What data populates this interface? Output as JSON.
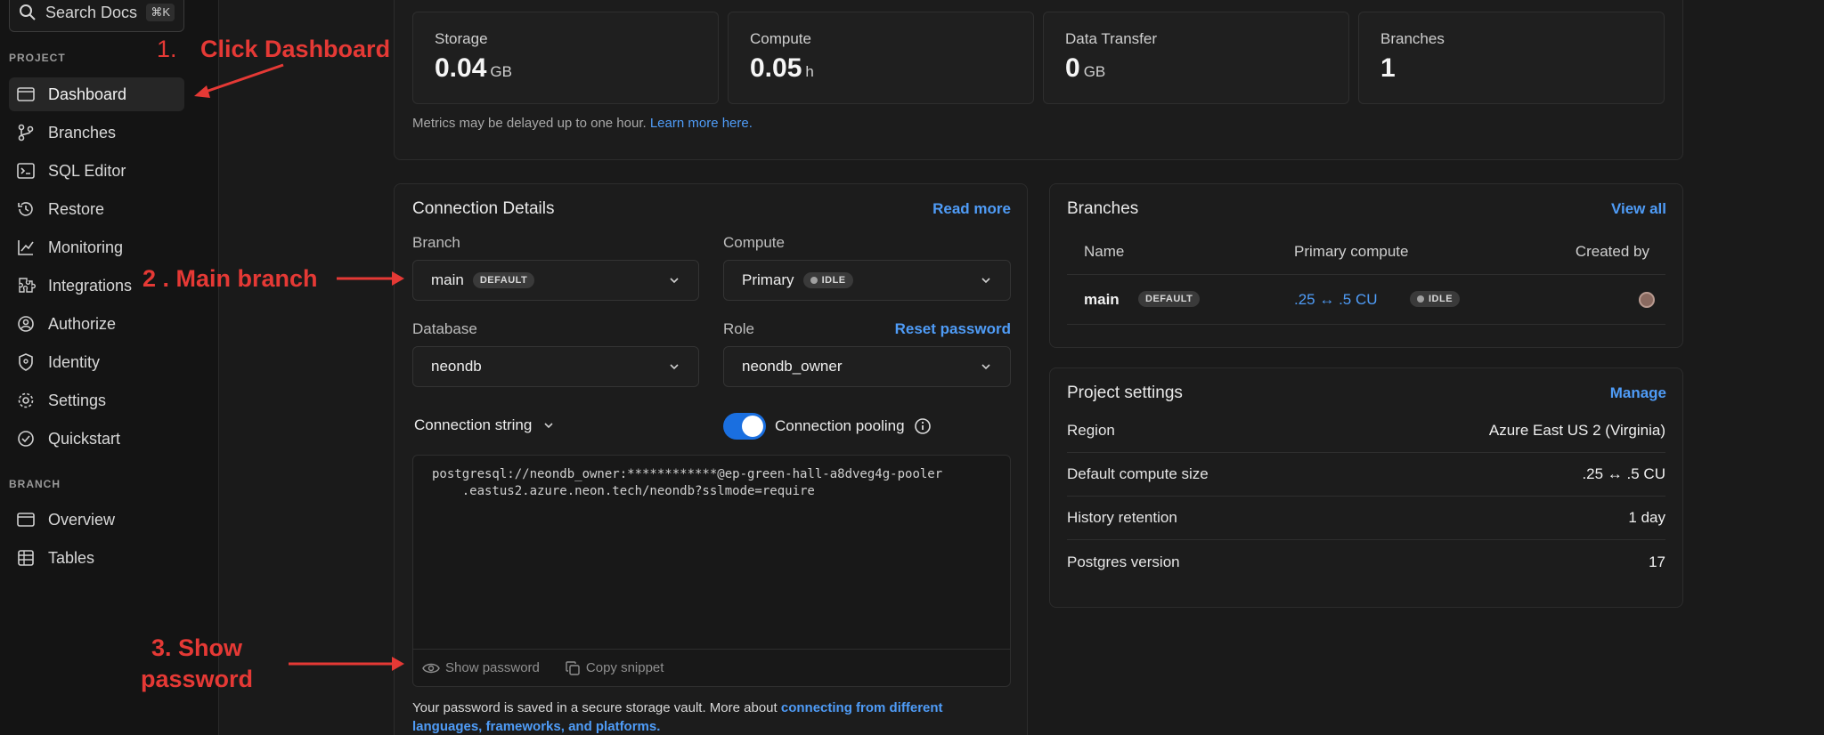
{
  "search": {
    "label": "Search Docs",
    "shortcut": "⌘K"
  },
  "sidebar": {
    "project_label": "PROJECT",
    "branch_label": "BRANCH",
    "project_items": [
      {
        "label": "Dashboard",
        "icon": "dashboard-icon"
      },
      {
        "label": "Branches",
        "icon": "branches-icon"
      },
      {
        "label": "SQL Editor",
        "icon": "sql-editor-icon"
      },
      {
        "label": "Restore",
        "icon": "restore-icon"
      },
      {
        "label": "Monitoring",
        "icon": "monitoring-icon"
      },
      {
        "label": "Integrations",
        "icon": "integrations-icon"
      },
      {
        "label": "Authorize",
        "icon": "authorize-icon"
      },
      {
        "label": "Identity",
        "icon": "identity-icon"
      },
      {
        "label": "Settings",
        "icon": "settings-icon"
      },
      {
        "label": "Quickstart",
        "icon": "quickstart-icon"
      }
    ],
    "branch_items": [
      {
        "label": "Overview",
        "icon": "overview-icon"
      },
      {
        "label": "Tables",
        "icon": "tables-icon"
      }
    ]
  },
  "usage": {
    "stats": [
      {
        "label": "Storage",
        "value": "0.04",
        "unit": "GB"
      },
      {
        "label": "Compute",
        "value": "0.05",
        "unit": "h"
      },
      {
        "label": "Data Transfer",
        "value": "0",
        "unit": "GB"
      },
      {
        "label": "Branches",
        "value": "1",
        "unit": ""
      }
    ],
    "note": "Metrics may be delayed up to one hour.",
    "note_link": "Learn more here."
  },
  "connection": {
    "title": "Connection Details",
    "read_more": "Read more",
    "branch_label": "Branch",
    "branch_value": "main",
    "branch_badge": "DEFAULT",
    "compute_label": "Compute",
    "compute_value": "Primary",
    "compute_badge": "IDLE",
    "database_label": "Database",
    "database_value": "neondb",
    "role_label": "Role",
    "reset_password": "Reset password",
    "role_value": "neondb_owner",
    "conn_string_label": "Connection string",
    "pooling_label": "Connection pooling",
    "pooling_on": true,
    "conn_line1": "postgresql://neondb_owner:************@ep-green-hall-a8dveg4g-pooler",
    "conn_line2": "    .eastus2.azure.neon.tech/neondb?sslmode=require",
    "show_password": "Show password",
    "copy_snippet": "Copy snippet",
    "footer_text": "Your password is saved in a secure storage vault. More about",
    "footer_link1": "connecting from different",
    "footer_link2": "languages, frameworks, and platforms."
  },
  "branches": {
    "title": "Branches",
    "view_all": "View all",
    "columns": [
      "Name",
      "Primary compute",
      "Created by"
    ],
    "rows": [
      {
        "name": "main",
        "badge": "DEFAULT",
        "compute": ".25 ↔ .5 CU",
        "status": "IDLE"
      }
    ]
  },
  "project_settings": {
    "title": "Project settings",
    "manage": "Manage",
    "rows": [
      {
        "label": "Region",
        "value": "Azure East US 2 (Virginia)"
      },
      {
        "label": "Default compute size",
        "value": ".25 ↔ .5 CU"
      },
      {
        "label": "History retention",
        "value": "1 day"
      },
      {
        "label": "Postgres version",
        "value": "17"
      }
    ]
  },
  "annotations": {
    "step1_num": "1.",
    "step1": "Click Dashboard",
    "step2": "2 . Main branch",
    "step3_line1": "3. Show",
    "step3_line2": "password"
  },
  "colors": {
    "accent": "#4f9cf7",
    "annotation": "#e53935",
    "toggle": "#1a6fe0"
  }
}
